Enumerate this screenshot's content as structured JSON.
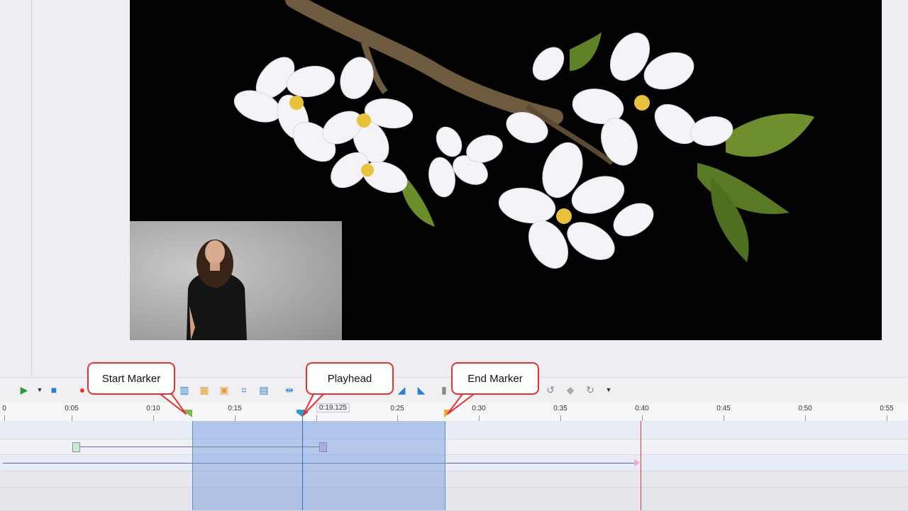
{
  "callouts": {
    "start": "Start Marker",
    "playhead": "Playhead",
    "end": "End Marker"
  },
  "playhead_time": "0:19.125",
  "ruler_ticks": [
    "0",
    "0:05",
    "0:10",
    "0:15",
    "0:20",
    "0:25",
    "0:30",
    "0:35",
    "0:40",
    "0:45",
    "0:50",
    "0:55"
  ],
  "colors": {
    "start_marker": "#7ab648",
    "playhead_marker": "#2f9bc8",
    "end_marker": "#f2a93b",
    "callout_border": "#e3322f",
    "selection": "#6e96dc",
    "end_line": "#e0373b"
  },
  "toolbar_icons": [
    "play-icon",
    "dropdown-icon",
    "stop-icon",
    "record-icon",
    "align-icon",
    "distribute-icon",
    "group-icon",
    "crop-icon",
    "arrange-icon",
    "split-icon",
    "fade-in-icon",
    "fade-out-icon",
    "audio-levels-icon",
    "undo-icon",
    "diamond-icon",
    "redo-icon",
    "more-icon"
  ]
}
